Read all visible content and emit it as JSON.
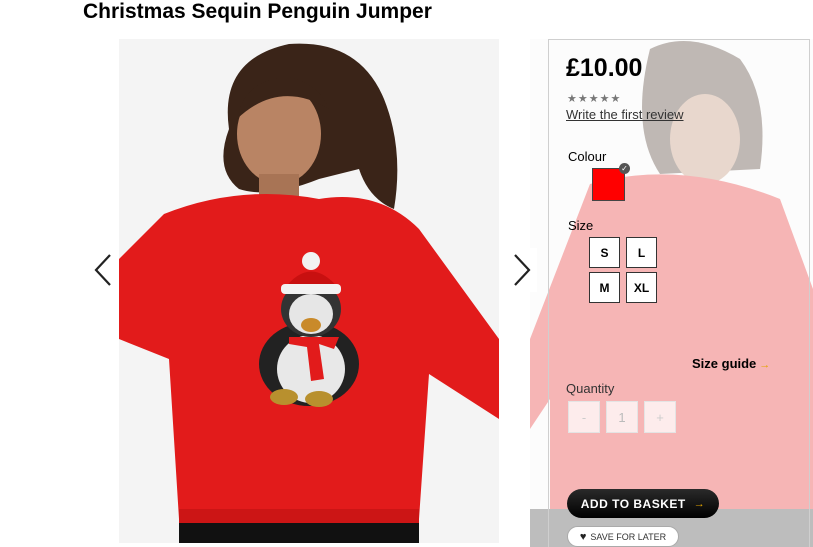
{
  "product": {
    "title": "Christmas Sequin Penguin Jumper",
    "price": "£10.00",
    "rating_stars": "★★★★★",
    "review_link": "Write the first review"
  },
  "colour": {
    "label": "Colour",
    "selected_color": "#ff0000"
  },
  "size": {
    "label": "Size",
    "options": [
      "S",
      "L",
      "M",
      "XL"
    ],
    "guide_label": "Size guide",
    "guide_arrow": "→"
  },
  "quantity": {
    "label": "Quantity",
    "minus": "-",
    "value": "1",
    "plus": "+"
  },
  "actions": {
    "add_to_basket": "ADD TO BASKET",
    "add_arrow": "→",
    "save_for_later": "SAVE FOR LATER",
    "heart": "♥"
  },
  "colors": {
    "jumper": "#e21b1b",
    "accent": "#e2a400"
  }
}
